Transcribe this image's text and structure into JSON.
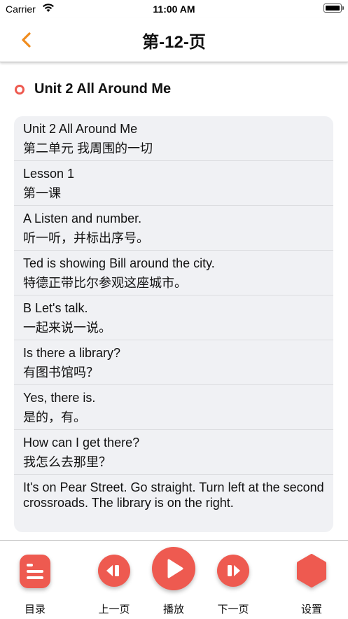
{
  "status_bar": {
    "carrier": "Carrier",
    "time": "11:00 AM"
  },
  "nav": {
    "title": "第-12-页",
    "back_icon": "chevron-left-icon",
    "accent_color": "#f08c1e"
  },
  "section": {
    "title": "Unit 2 All Around Me",
    "dot_color": "#ee5a50"
  },
  "entries": [
    {
      "en": "Unit 2 All Around Me",
      "zh": "第二单元 我周围的一切"
    },
    {
      "en": "Lesson 1",
      "zh": "第一课"
    },
    {
      "en": "A Listen and number.",
      "zh": "听一听，并标出序号。"
    },
    {
      "en": "Ted is showing Bill around the city.",
      "zh": "特德正带比尔参观这座城市。"
    },
    {
      "en": "B Let's talk.",
      "zh": "一起来说一说。"
    },
    {
      "en": "Is there a library?",
      "zh": "有图书馆吗？"
    },
    {
      "en": "Yes, there is.",
      "zh": "是的，有。"
    },
    {
      "en": "How can I get there?",
      "zh": "我怎么去那里？"
    },
    {
      "en": "It's on Pear Street. Go straight. Turn left at the second crossroads. The library is on the right.",
      "zh": ""
    }
  ],
  "tabs": {
    "menu": {
      "label": "目录",
      "icon": "list-icon"
    },
    "prev": {
      "label": "上一页",
      "icon": "previous-page-icon"
    },
    "play": {
      "label": "播放",
      "icon": "play-icon"
    },
    "next": {
      "label": "下一页",
      "icon": "next-page-icon"
    },
    "settings": {
      "label": "设置",
      "icon": "settings-hexagon-icon"
    }
  },
  "colors": {
    "brand": "#ee5a50",
    "card_bg": "#f0f1f4"
  }
}
